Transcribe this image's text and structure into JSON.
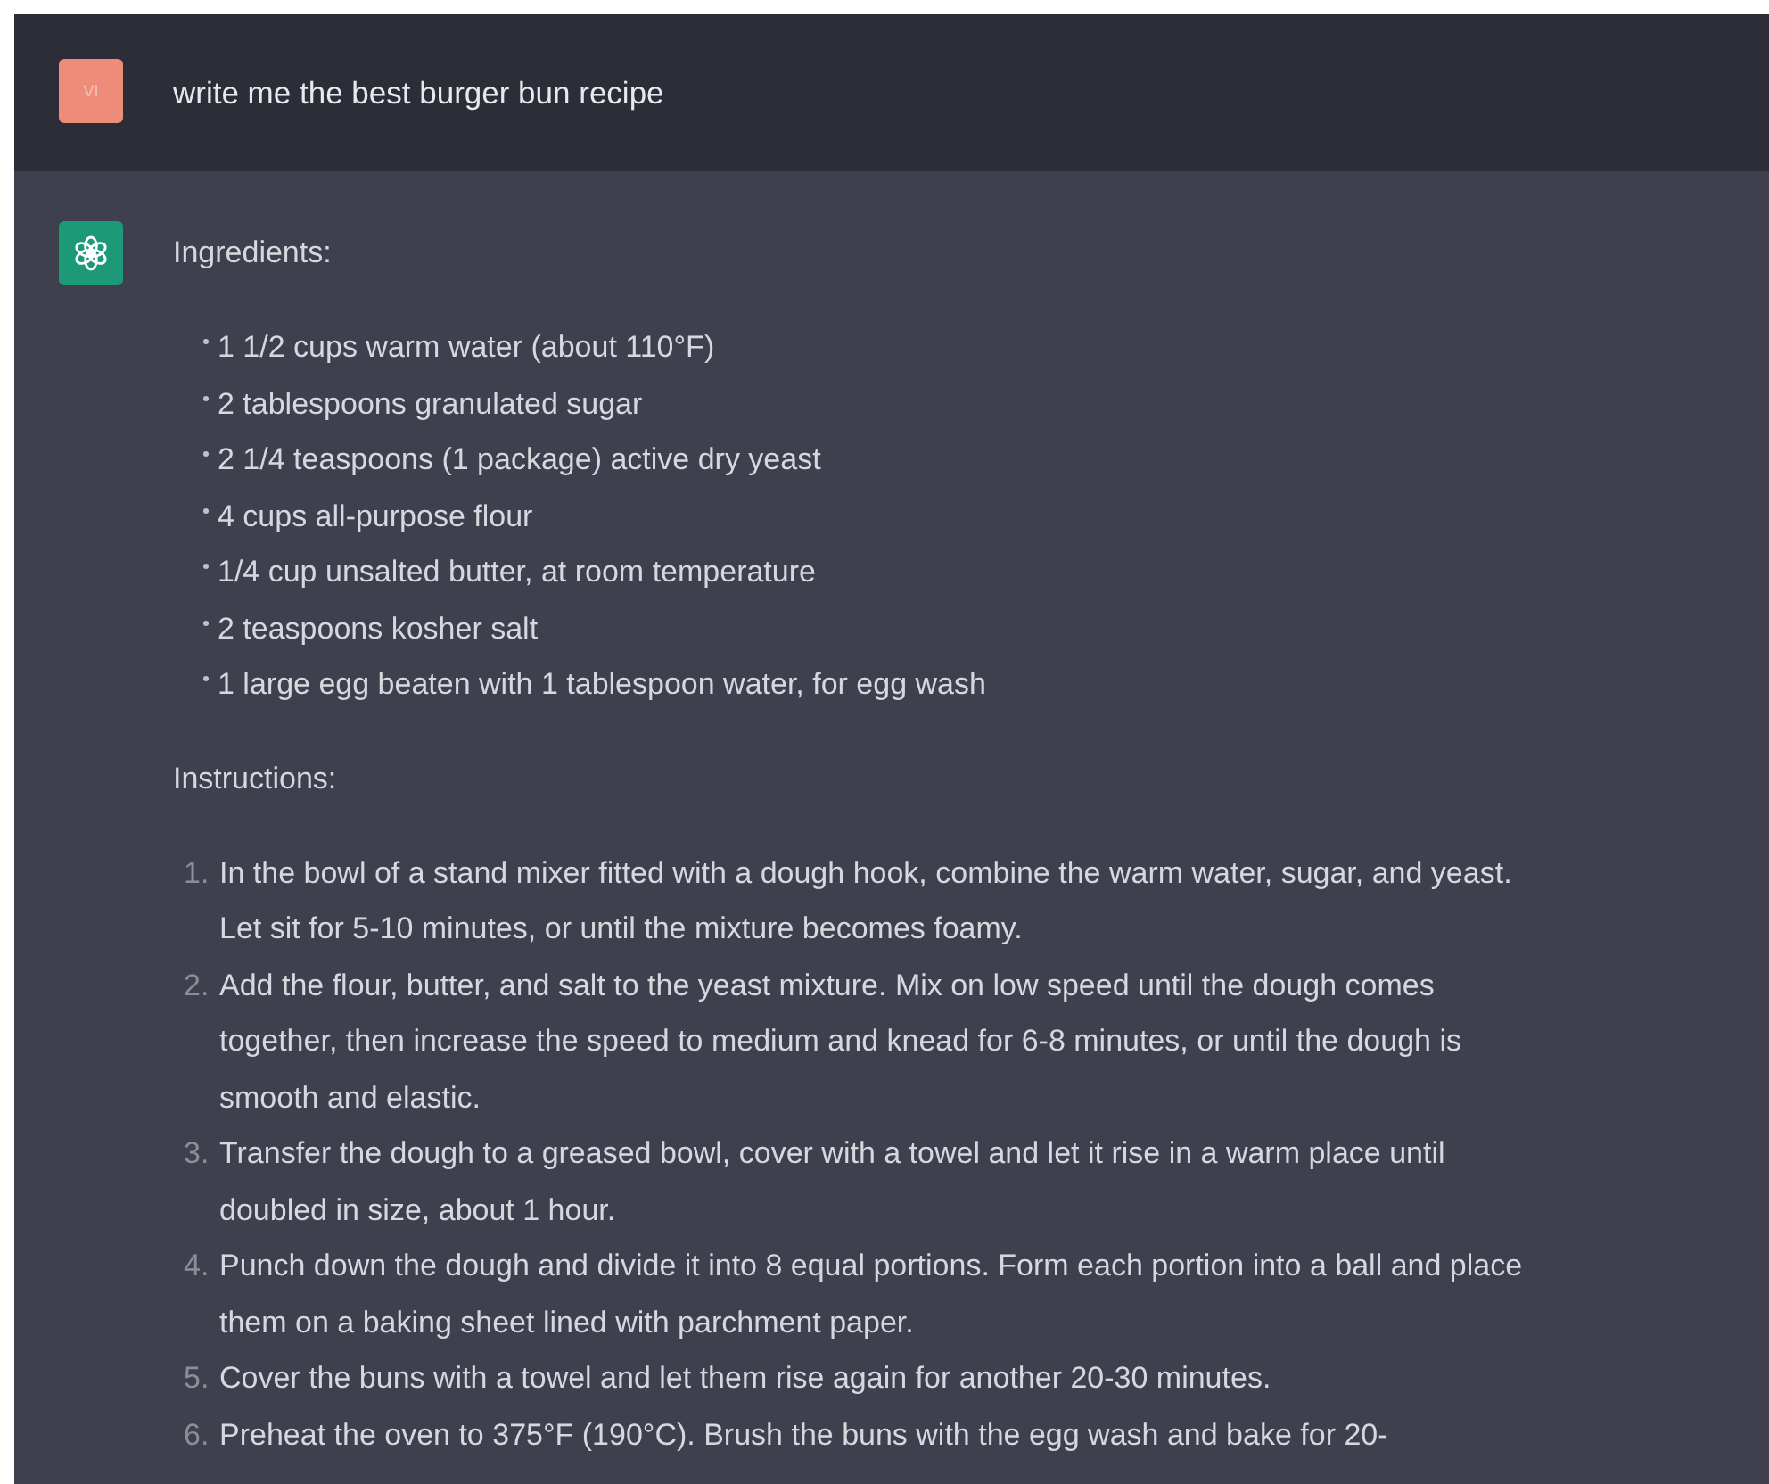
{
  "messages": [
    {
      "kind": "user",
      "avatar": "VI",
      "text": "write me the best burger bun recipe"
    },
    {
      "kind": "assistant",
      "sections": [
        {
          "heading": "Ingredients:",
          "kind": "bullets",
          "items": [
            "1 1/2 cups warm water (about 110°F)",
            "2 tablespoons granulated sugar",
            "2 1/4 teaspoons (1 package) active dry yeast",
            "4 cups all-purpose flour",
            "1/4 cup unsalted butter, at room temperature",
            "2 teaspoons kosher salt",
            "1 large egg beaten with 1 tablespoon water, for egg wash"
          ]
        },
        {
          "heading": "Instructions:",
          "kind": "numbered",
          "items": [
            {
              "number": "1.",
              "text": "In the bowl of a stand mixer fitted with a dough hook, combine the warm water, sugar, and yeast. Let sit for 5-10 minutes, or until the mixture becomes foamy."
            },
            {
              "number": "2.",
              "text": "Add the flour, butter, and salt to the yeast mixture. Mix on low speed until the dough comes together, then increase the speed to medium and knead for 6-8 minutes, or until the dough is smooth and elastic."
            },
            {
              "number": "3.",
              "text": "Transfer the dough to a greased bowl, cover with a towel and let it rise in a warm place until doubled in size, about 1 hour."
            },
            {
              "number": "4.",
              "text": "Punch down the dough and divide it into 8 equal portions. Form each portion into a ball and place them on a baking sheet lined with parchment paper."
            },
            {
              "number": "5.",
              "text": "Cover the buns with a towel and let them rise again for another 20-30 minutes."
            },
            {
              "number": "6.",
              "text": "Preheat the oven to 375°F (190°C). Brush the buns with the egg wash and bake for 20-"
            }
          ]
        }
      ]
    }
  ]
}
